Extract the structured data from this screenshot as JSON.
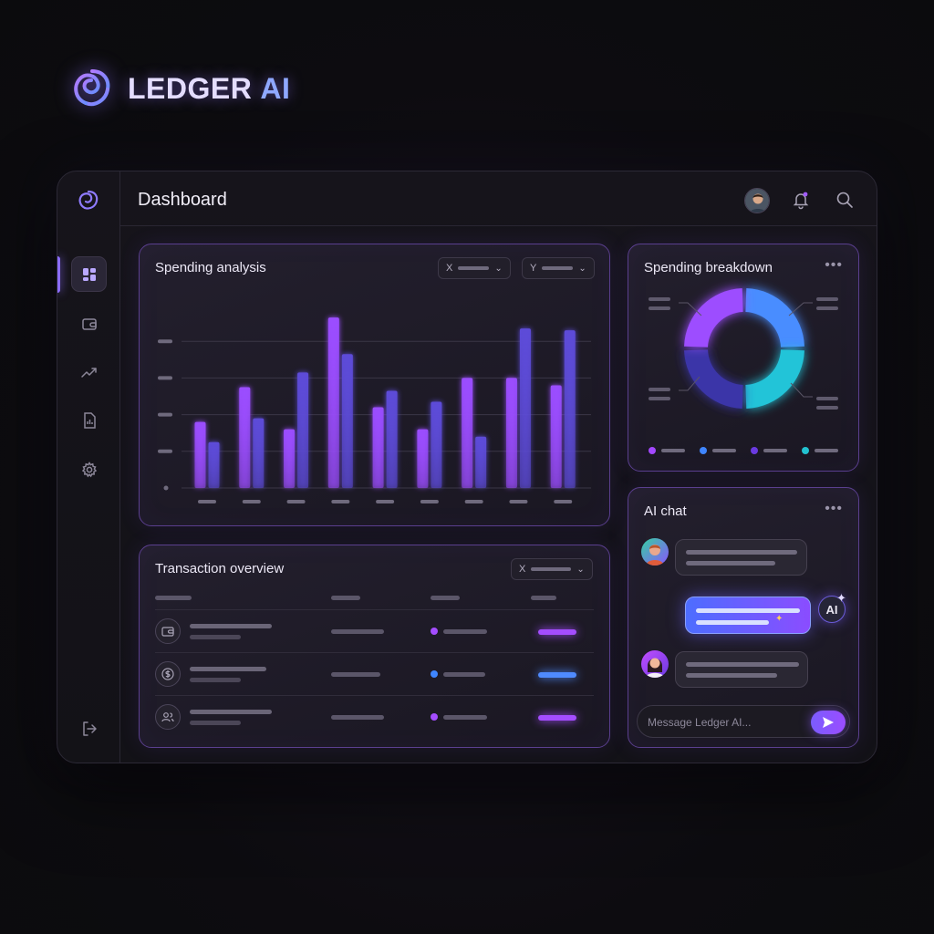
{
  "brand": {
    "name": "LEDGER",
    "suffix": "AI"
  },
  "header": {
    "title": "Dashboard"
  },
  "sidebar": {
    "items": [
      {
        "id": "dashboard",
        "icon": "grid-icon",
        "active": true
      },
      {
        "id": "wallet",
        "icon": "wallet-icon",
        "active": false
      },
      {
        "id": "trends",
        "icon": "trend-up-icon",
        "active": false
      },
      {
        "id": "reports",
        "icon": "report-icon",
        "active": false
      },
      {
        "id": "settings",
        "icon": "gear-icon",
        "active": false
      }
    ],
    "footer_icon": "logout-icon"
  },
  "spending_analysis": {
    "title": "Spending analysis",
    "filters": [
      {
        "label": "X"
      },
      {
        "label": "Y"
      }
    ]
  },
  "chart_data": {
    "type": "bar",
    "categories": [
      "",
      "",
      "",
      "",
      "",
      "",
      "",
      "",
      ""
    ],
    "series": [
      {
        "values": [
          36,
          55,
          32,
          93,
          44,
          32,
          60,
          60,
          56
        ]
      },
      {
        "values": [
          25,
          38,
          63,
          73,
          53,
          47,
          28,
          87,
          86
        ]
      }
    ],
    "ylim": [
      0,
      100
    ],
    "grid": true,
    "colors": [
      "#9b4dff",
      "#5d4bd8"
    ]
  },
  "spending_breakdown": {
    "title": "Spending breakdown",
    "menu_icon": "more-horizontal-icon",
    "segments": [
      {
        "share": 0.25,
        "color": "#4a8dff"
      },
      {
        "share": 0.25,
        "color": "#23c4d8"
      },
      {
        "share": 0.25,
        "color": "#3b36a8"
      },
      {
        "share": 0.25,
        "color": "#9d4dff"
      }
    ],
    "legend_colors": [
      "#a348ff",
      "#3f86ff",
      "#6a3ae0",
      "#22c2d0"
    ]
  },
  "transactions": {
    "title": "Transaction overview",
    "filter": {
      "label": "X"
    },
    "rows": [
      {
        "icon": "wallet-icon",
        "status_color": "#a44dff",
        "dot_color": "#a44dff"
      },
      {
        "icon": "dollar-icon",
        "status_color": "#4f8bff",
        "dot_color": "#3f86ff"
      },
      {
        "icon": "users-icon",
        "status_color": "#a44dff",
        "dot_color": "#a44dff"
      }
    ]
  },
  "ai_chat": {
    "title": "AI chat",
    "menu_icon": "more-horizontal-icon",
    "ai_badge": "AI",
    "input": {
      "placeholder": "Message Ledger AI..."
    },
    "send_icon": "send-icon"
  }
}
